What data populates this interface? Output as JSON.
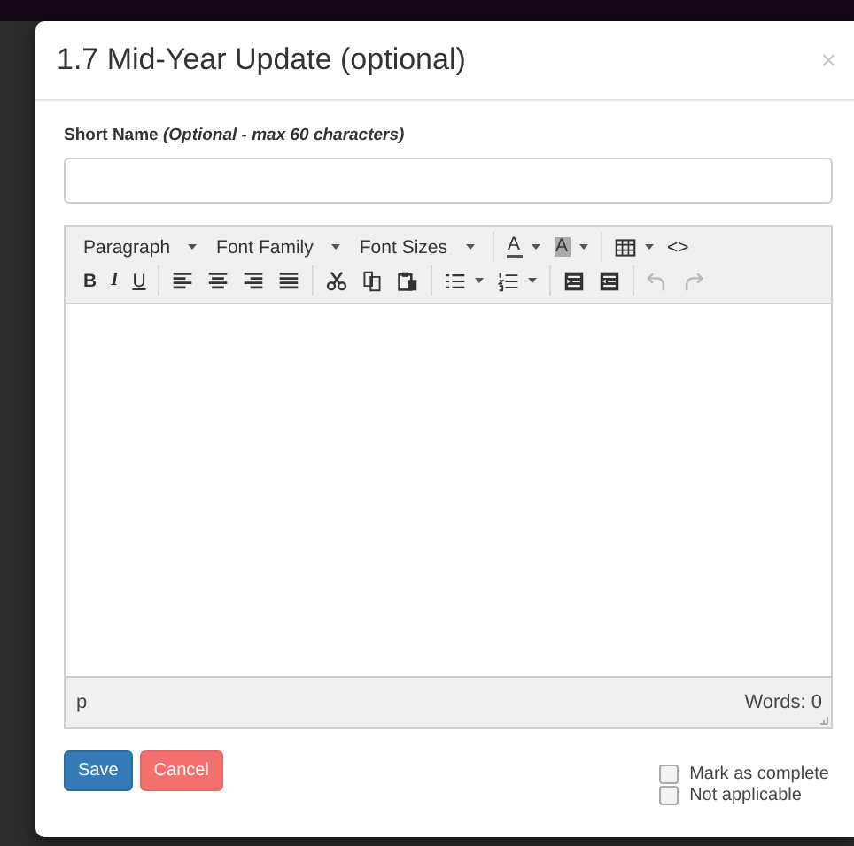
{
  "dialog": {
    "title": "1.7 Mid-Year Update (optional)",
    "close": "×"
  },
  "short_name": {
    "label": "Short Name *(Optional - max 60 characters)*"
  },
  "editor": {
    "toolbar": [
      [
        [
          {
            "kind": "dropdown",
            "label": "Paragraph"
          },
          {
            "kind": "dropdown",
            "label": "Font Family"
          },
          {
            "kind": "dropdown",
            "label": "Font Sizes"
          }
        ],
        [
          {
            "kind": "forecolor",
            "label": "A",
            "caret": true
          },
          {
            "kind": "backcolor",
            "label": "A",
            "caret": true
          }
        ],
        [
          {
            "kind": "icon",
            "caret": true
          },
          {
            "kind": "code",
            "label": "<>"
          }
        ]
      ],
      [
        [
          {
            "kind": "bold",
            "label": "B"
          },
          {
            "kind": "italic",
            "label": "I"
          },
          {
            "kind": "underline",
            "label": "U"
          }
        ],
        [
          {
            "kind": "icon"
          },
          {
            "kind": "icon"
          },
          {
            "kind": "icon"
          },
          {
            "kind": "icon"
          }
        ],
        [
          {
            "kind": "icon"
          },
          {
            "kind": "icon"
          },
          {
            "kind": "icon"
          }
        ],
        [
          {
            "kind": "icon",
            "caret": true
          },
          {
            "kind": "icon",
            "caret": true
          }
        ],
        [
          {
            "kind": "icon"
          },
          {
            "kind": "icon"
          }
        ],
        [
          {
            "kind": "icon",
            "disabled": true
          },
          {
            "kind": "icon",
            "disabled": true
          }
        ]
      ]
    ],
    "path": "p",
    "word_count": "Words: 0"
  },
  "buttons": [
    {
      "kind": "primary",
      "label": "Save"
    },
    {
      "kind": "danger",
      "label": "Cancel"
    }
  ],
  "checkboxes": [
    {
      "label": "Mark as complete",
      "checked": false
    },
    {
      "label": "Not applicable",
      "checked": false
    }
  ]
}
